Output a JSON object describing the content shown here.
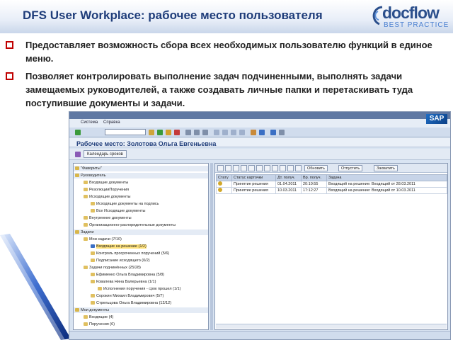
{
  "slide": {
    "title": "DFS User Workplace: рабочее место пользователя",
    "logo_text": "docflow",
    "logo_sub": "BEST PRACTICE",
    "bullets": [
      "Предоставляет возможность сбора всех необходимых пользователю функций в единое меню.",
      "Позволяет контролировать выполнение задач подчиненными, выполнять задачи замещаемых руководителей, а также создавать личные папки и перетаскивать туда поступившие документы и задачи."
    ]
  },
  "sap": {
    "menu": [
      "Система",
      "Справка"
    ],
    "logo": "SAP",
    "window_title": "Рабочее место: Золотова Ольга Евгеньевна",
    "calendar_button": "Календарь сроков",
    "tree": [
      {
        "label": "\"Фавориты\"",
        "kind": "sec"
      },
      {
        "label": "Руководитель",
        "kind": "sec"
      },
      {
        "label": "Входящие документы",
        "kind": "item"
      },
      {
        "label": "РезолюцииПоручения",
        "kind": "item"
      },
      {
        "label": "Исходящие документы",
        "kind": "item"
      },
      {
        "label": "Исходящие документы на подпись",
        "kind": "item"
      },
      {
        "label": "Все Исходящие документы",
        "kind": "item"
      },
      {
        "label": "Внутренние документы",
        "kind": "item"
      },
      {
        "label": "Организационно-распорядительные документы",
        "kind": "item"
      },
      {
        "label": "Задачи",
        "kind": "sec"
      },
      {
        "label": "Мои задачи (7/10)",
        "kind": "item"
      },
      {
        "label": "Входящие на решение (1/2)",
        "kind": "sel"
      },
      {
        "label": "Контроль просроченных поручений (5/6)",
        "kind": "item"
      },
      {
        "label": "Подписание исходящего (0/2)",
        "kind": "item"
      },
      {
        "label": "Задачи подчинённых (25/28)",
        "kind": "item"
      },
      {
        "label": "Ефименко Ольга Владимировна (5/8)",
        "kind": "item"
      },
      {
        "label": "Ковалева Нина Валерьевна (1/1)",
        "kind": "item"
      },
      {
        "label": "Исполнения поручения - срок прошел (1/1)",
        "kind": "item"
      },
      {
        "label": "Сорокин Михаил Владимирович (5/7)",
        "kind": "item"
      },
      {
        "label": "Стрельцова Ольга Владимировна (12/12)",
        "kind": "item"
      },
      {
        "label": "Мои документы",
        "kind": "sec"
      },
      {
        "label": "Входящие (4)",
        "kind": "item"
      },
      {
        "label": "Поручения (6)",
        "kind": "item"
      }
    ],
    "right_buttons": [
      "Обновить",
      "Отпустить",
      "Захватить"
    ],
    "table": {
      "headers": [
        "Стату",
        "Статус карточки",
        "Дт. получ.",
        "Вр. получ.",
        "Задача"
      ],
      "rows": [
        [
          "",
          "Принятие решения",
          "01.04.2011",
          "20:10:55",
          "Входящий на решение: Входящий от 28.03.2011"
        ],
        [
          "",
          "Принятие решения",
          "10.03.2011",
          "17:12:27",
          "Входящий на решение: Входящий от 10.03.2011"
        ]
      ]
    }
  }
}
